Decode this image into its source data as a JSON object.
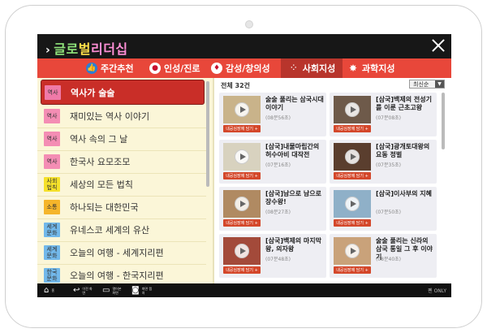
{
  "header": {
    "title_parts": [
      "글로",
      "벌",
      "리더십"
    ]
  },
  "tabs": [
    {
      "label": "주간추천",
      "icon": "thumbs-up-icon",
      "icon_color": "#2a7fd4",
      "active": false
    },
    {
      "label": "인성/진로",
      "icon": "heart-icon",
      "icon_color": "#c8102e",
      "active": false
    },
    {
      "label": "감성/창의성",
      "icon": "lightbulb-icon",
      "icon_color": "#c8102e",
      "active": false
    },
    {
      "label": "사회지성",
      "icon": "network-icon",
      "icon_color": "#ffffff",
      "active": true
    },
    {
      "label": "과학지성",
      "icon": "sparkle-icon",
      "icon_color": "#ffffff",
      "active": false
    }
  ],
  "left_list": [
    {
      "badge": "역사",
      "badge_color": "#f07aa8",
      "label": "역사가 술술",
      "active": true
    },
    {
      "badge": "역사",
      "badge_color": "#f48db4",
      "label": "재미있는 역사 이야기",
      "active": false
    },
    {
      "badge": "역사",
      "badge_color": "#f48db4",
      "label": "역사 속의 그 날",
      "active": false
    },
    {
      "badge": "역사",
      "badge_color": "#f48db4",
      "label": "한국사 요모조모",
      "active": false
    },
    {
      "badge": "사회\n법칙",
      "badge_color": "#f5e12a",
      "label": "세상의 모든 법칙",
      "active": false
    },
    {
      "badge": "소통",
      "badge_color": "#f5b52a",
      "label": "하나되는 대한민국",
      "active": false
    },
    {
      "badge": "세계\n문화",
      "badge_color": "#72b8ea",
      "label": "유네스코 세계의 유산",
      "active": false
    },
    {
      "badge": "세계\n문화",
      "badge_color": "#72b8ea",
      "label": "오늘의 여행 - 세계지리편",
      "active": false
    },
    {
      "badge": "한국\n문화",
      "badge_color": "#72b8ea",
      "label": "오늘의 여행 - 한국지리편",
      "active": false
    }
  ],
  "right": {
    "total": "전체 32건",
    "sort": "최신순",
    "mylist_label": "내공심장에 담기 +",
    "cards": [
      {
        "title": "술술 풀리는 삼국시대 이야기",
        "duration": "(08분56초)"
      },
      {
        "title": "[삼국]백제의 전성기를 이룬 근초고왕",
        "duration": "(07분08초)"
      },
      {
        "title": "[삼국]내물마립간의 허수아비 대작전",
        "duration": "(07분16초)"
      },
      {
        "title": "[삼국]광개토대왕의 요동 정벌",
        "duration": "(07분35초)"
      },
      {
        "title": "[삼국]남으로 남으로 장수왕!",
        "duration": "(08분27초)"
      },
      {
        "title": "[삼국]이사부의 지혜",
        "duration": "(07분50초)"
      },
      {
        "title": "[삼국]백제의 마지막 왕, 의자왕",
        "duration": "(07분48초)"
      },
      {
        "title": "술술 풀리는 신라의 삼국 통일 그 후 이야기",
        "duration": "(08분40초)"
      }
    ]
  },
  "navbar": {
    "items": [
      {
        "label": "홈",
        "icon": "home-icon"
      },
      {
        "label": "이전 화면",
        "icon": "back-icon"
      },
      {
        "label": "열어본 화면",
        "icon": "recent-apps-icon"
      },
      {
        "label": "화면 캡처",
        "icon": "screenshot-icon"
      }
    ],
    "pen_only": "펜 ONLY"
  }
}
